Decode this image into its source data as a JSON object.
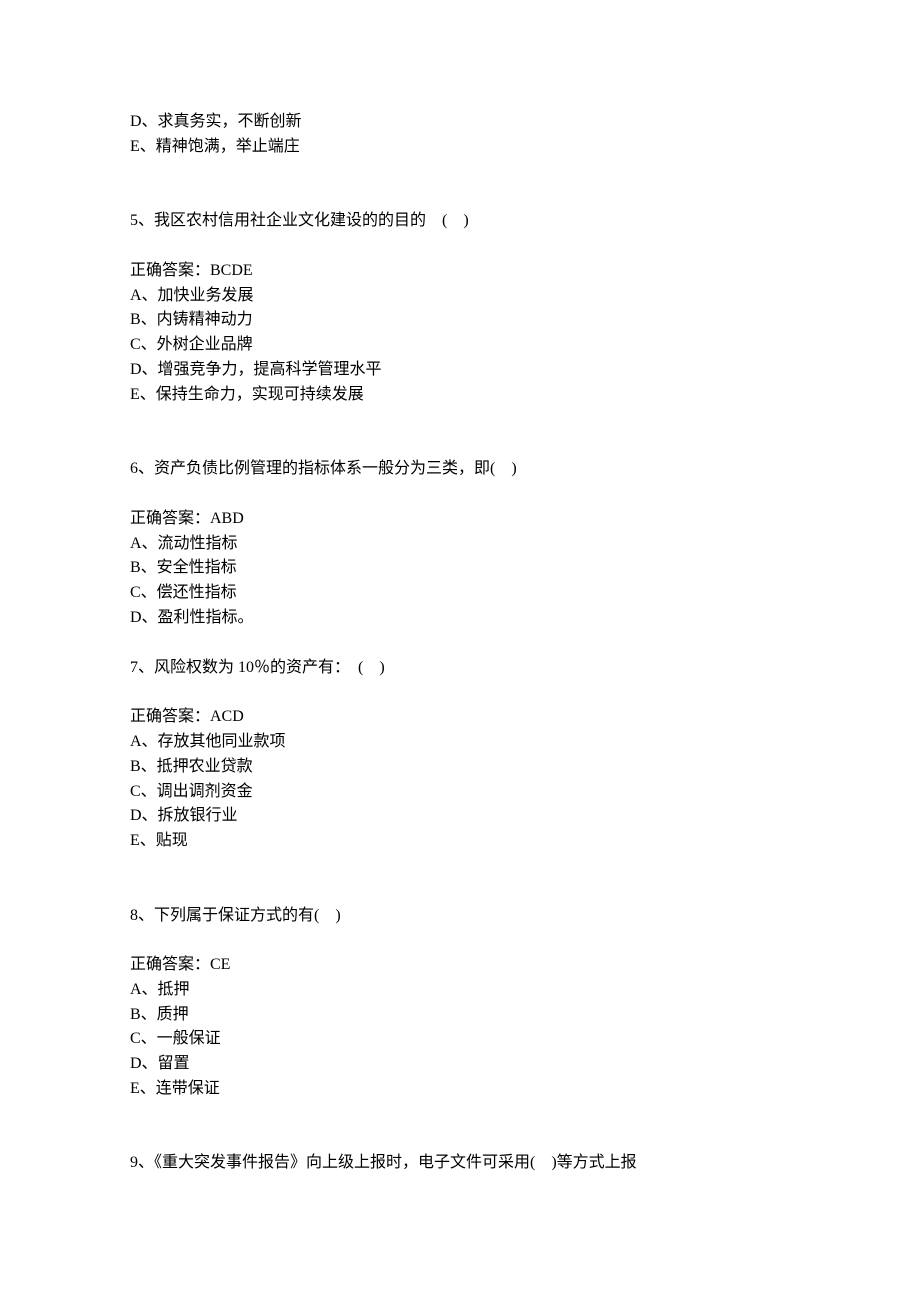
{
  "prev_options": [
    "D、求真务实，不断创新",
    "E、精神饱满，举止端庄"
  ],
  "q5": {
    "stem": "5、我区农村信用社企业文化建设的的目的　(　)",
    "answer": "正确答案：BCDE",
    "options": [
      "A、加快业务发展",
      "B、内铸精神动力",
      "C、外树企业品牌",
      "D、增强竞争力，提高科学管理水平",
      "E、保持生命力，实现可持续发展"
    ]
  },
  "q6": {
    "stem": "6、资产负债比例管理的指标体系一般分为三类，即(　)",
    "answer": "正确答案：ABD",
    "options": [
      "A、流动性指标",
      "B、安全性指标",
      "C、偿还性指标",
      "D、盈利性指标。"
    ]
  },
  "q7": {
    "stem": "7、风险权数为 10％的资产有：　(　)",
    "answer": "正确答案：ACD",
    "options": [
      "A、存放其他同业款项",
      "B、抵押农业贷款",
      "C、调出调剂资金",
      "D、拆放银行业",
      "E、贴现"
    ]
  },
  "q8": {
    "stem": "8、下列属于保证方式的有(　)",
    "answer": "正确答案：CE",
    "options": [
      "A、抵押",
      "B、质押",
      "C、一般保证",
      "D、留置",
      "E、连带保证"
    ]
  },
  "q9": {
    "stem": "9、《重大突发事件报告》向上级上报时，电子文件可采用(　)等方式上报"
  }
}
